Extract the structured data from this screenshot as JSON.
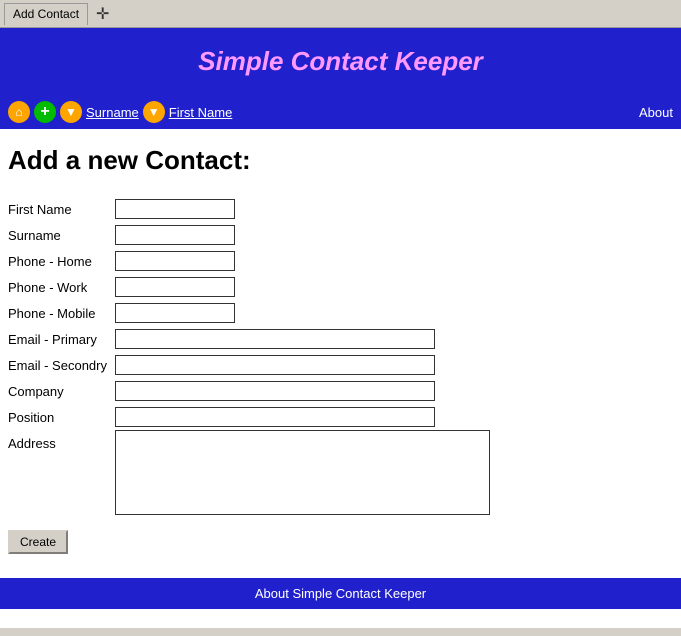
{
  "browser": {
    "tab_label": "Add Contact",
    "new_tab_icon": "✛"
  },
  "header": {
    "title": "Simple Contact Keeper"
  },
  "navbar": {
    "home_icon": "⌂",
    "add_icon": "+",
    "down_icon_1": "▼",
    "down_icon_2": "▼",
    "surname_label": "Surname",
    "firstname_label": "First Name",
    "about_label": "About"
  },
  "page": {
    "heading": "Add a new Contact:"
  },
  "form": {
    "fields": [
      {
        "label": "First Name",
        "type": "short"
      },
      {
        "label": "Surname",
        "type": "short"
      },
      {
        "label": "Phone - Home",
        "type": "short"
      },
      {
        "label": "Phone - Work",
        "type": "short"
      },
      {
        "label": "Phone - Mobile",
        "type": "short"
      },
      {
        "label": "Email - Primary",
        "type": "long"
      },
      {
        "label": "Email - Secondry",
        "type": "long"
      },
      {
        "label": "Company",
        "type": "long"
      },
      {
        "label": "Position",
        "type": "long"
      }
    ],
    "address_label": "Address",
    "create_button": "Create"
  },
  "footer": {
    "text": "About Simple Contact Keeper"
  }
}
